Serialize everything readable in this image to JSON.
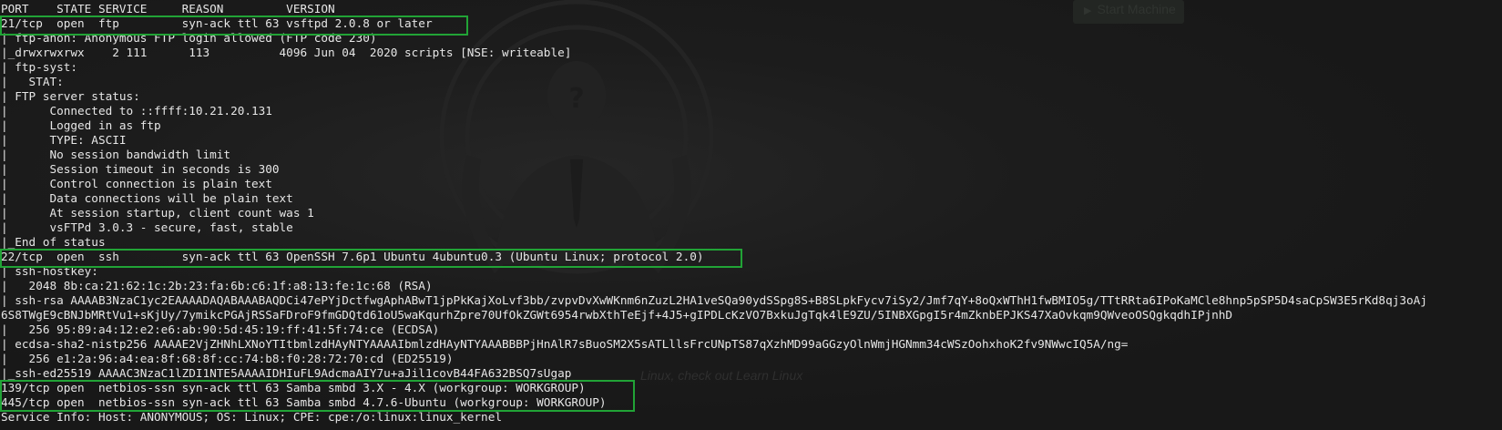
{
  "background": {
    "start_machine_label": "Start Machine",
    "hint_text": "Linux, check out Learn Linux"
  },
  "terminal": {
    "lines": [
      "PORT    STATE SERVICE     REASON         VERSION",
      "21/tcp  open  ftp         syn-ack ttl 63 vsftpd 2.0.8 or later",
      "| ftp-anon: Anonymous FTP login allowed (FTP code 230)",
      "|_drwxrwxrwx    2 111      113          4096 Jun 04  2020 scripts [NSE: writeable]",
      "| ftp-syst:",
      "|   STAT:",
      "| FTP server status:",
      "|      Connected to ::ffff:10.21.20.131",
      "|      Logged in as ftp",
      "|      TYPE: ASCII",
      "|      No session bandwidth limit",
      "|      Session timeout in seconds is 300",
      "|      Control connection is plain text",
      "|      Data connections will be plain text",
      "|      At session startup, client count was 1",
      "|      vsFTPd 3.0.3 - secure, fast, stable",
      "|_End of status",
      "22/tcp  open  ssh         syn-ack ttl 63 OpenSSH 7.6p1 Ubuntu 4ubuntu0.3 (Ubuntu Linux; protocol 2.0)",
      "| ssh-hostkey:",
      "|   2048 8b:ca:21:62:1c:2b:23:fa:6b:c6:1f:a8:13:fe:1c:68 (RSA)",
      "| ssh-rsa AAAAB3NzaC1yc2EAAAADAQABAAABAQDCi47ePYjDctfwgAphABwT1jpPkKajXoLvf3bb/zvpvDvXwWKnm6nZuzL2HA1veSQa90ydSSpg8S+B8SLpkFycv7iSy2/Jmf7qY+8oQxWThH1fwBMIO5g/TTtRRta6IPoKaMCle8hnp5pSP5D4saCpSW3E5rKd8qj3oAj",
      "6S8TWgE9cBNJbMRtVu1+sKjUy/7ymikcPGAjRSSaFDroF9fmGDQtd61oU5waKqurhZpre70UfOkZGWt6954rwbXthTeEjf+4J5+gIPDLcKzVO7BxkuJgTqk4lE9ZU/5INBXGpgI5r4mZknbEPJKS47XaOvkqm9QWveoOSQgkqdhIPjnhD",
      "|   256 95:89:a4:12:e2:e6:ab:90:5d:45:19:ff:41:5f:74:ce (ECDSA)",
      "| ecdsa-sha2-nistp256 AAAAE2VjZHNhLXNoYTItbmlzdHAyNTYAAAAIbmlzdHAyNTYAAABBBPjHnAlR7sBuoSM2X5sATLllsFrcUNpTS87qXzhMD99aGGzyOlnWmjHGNmm34cWSzOohxhoK2fv9NWwcIQ5A/ng=",
      "|   256 e1:2a:96:a4:ea:8f:68:8f:cc:74:b8:f0:28:72:70:cd (ED25519)",
      "|_ssh-ed25519 AAAAC3NzaC1lZDI1NTE5AAAAIDHIuFL9AdcmaAIY7u+aJil1covB44FA632BSQ7sUgap",
      "139/tcp open  netbios-ssn syn-ack ttl 63 Samba smbd 3.X - 4.X (workgroup: WORKGROUP)",
      "445/tcp open  netbios-ssn syn-ack ttl 63 Samba smbd 4.7.6-Ubuntu (workgroup: WORKGROUP)",
      "Service Info: Host: ANONYMOUS; OS: Linux; CPE: cpe:/o:linux:linux_kernel"
    ]
  },
  "highlights": {
    "color": "#21a336",
    "ports": [
      "21/tcp",
      "22/tcp",
      "139/tcp",
      "445/tcp"
    ]
  }
}
